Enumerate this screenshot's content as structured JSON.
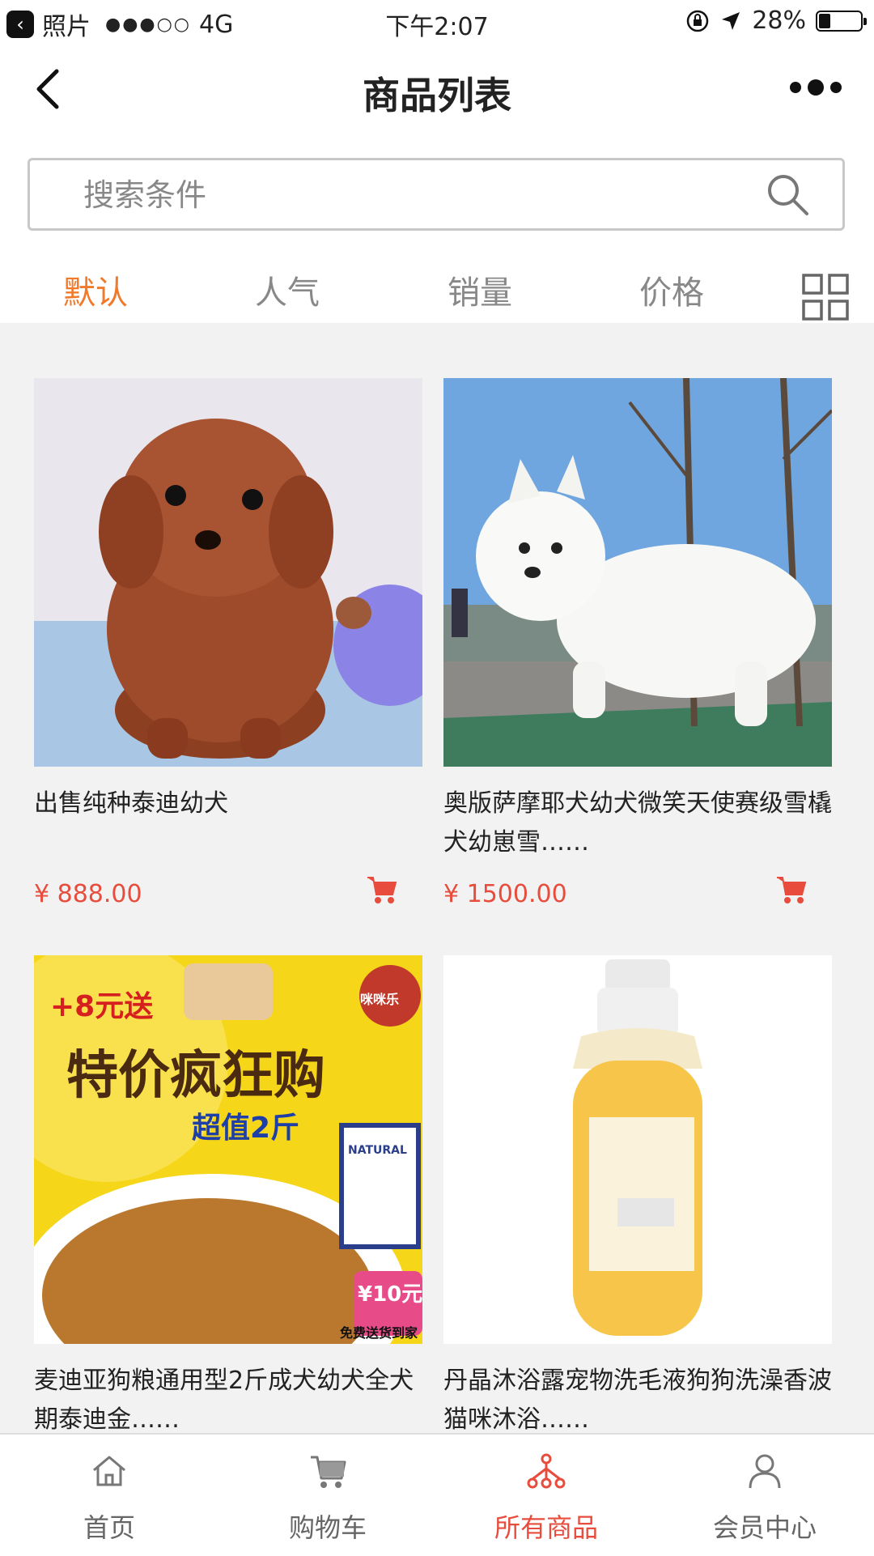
{
  "status": {
    "back_app": "照片",
    "signal": "●●●○○",
    "network": "4G",
    "time": "下午2:07",
    "battery": "28%",
    "battery_level": 0.28
  },
  "nav": {
    "title": "商品列表",
    "back_icon": "chevron-left-icon",
    "more_icon": "more-dots-icon"
  },
  "search": {
    "placeholder": "搜索条件",
    "icon": "search-icon"
  },
  "sort_tabs": [
    {
      "label": "默认",
      "active": true
    },
    {
      "label": "人气",
      "active": false
    },
    {
      "label": "销量",
      "active": false
    },
    {
      "label": "价格",
      "active": false
    }
  ],
  "products": [
    {
      "title": "出售纯种泰迪幼犬",
      "price": "¥ 888.00"
    },
    {
      "title": "奥版萨摩耶犬幼犬微笑天使赛级雪橇犬幼崽雪……",
      "price": "¥ 1500.00"
    },
    {
      "title": "麦迪亚狗粮通用型2斤成犬幼犬全犬期泰迪金……",
      "price": ""
    },
    {
      "title": "丹晶沐浴露宠物洗毛液狗狗洗澡香波猫咪沐浴……",
      "price": ""
    }
  ],
  "food_ad": {
    "promo": "+8元送",
    "headline": "特价疯狂购",
    "sub": "超值2斤",
    "badge": "¥10元",
    "delivery": "免费送货到家",
    "brand": "咪咪乐",
    "bag": "NATURAL"
  },
  "tabbar": [
    {
      "label": "首页",
      "icon": "home-icon",
      "active": false
    },
    {
      "label": "购物车",
      "icon": "cart-icon",
      "active": false
    },
    {
      "label": "所有商品",
      "icon": "network-icon",
      "active": true
    },
    {
      "label": "会员中心",
      "icon": "user-icon",
      "active": false
    }
  ],
  "colors": {
    "accent": "#f07a2a",
    "price": "#e74c3c",
    "active_tab": "#e74c3c"
  }
}
